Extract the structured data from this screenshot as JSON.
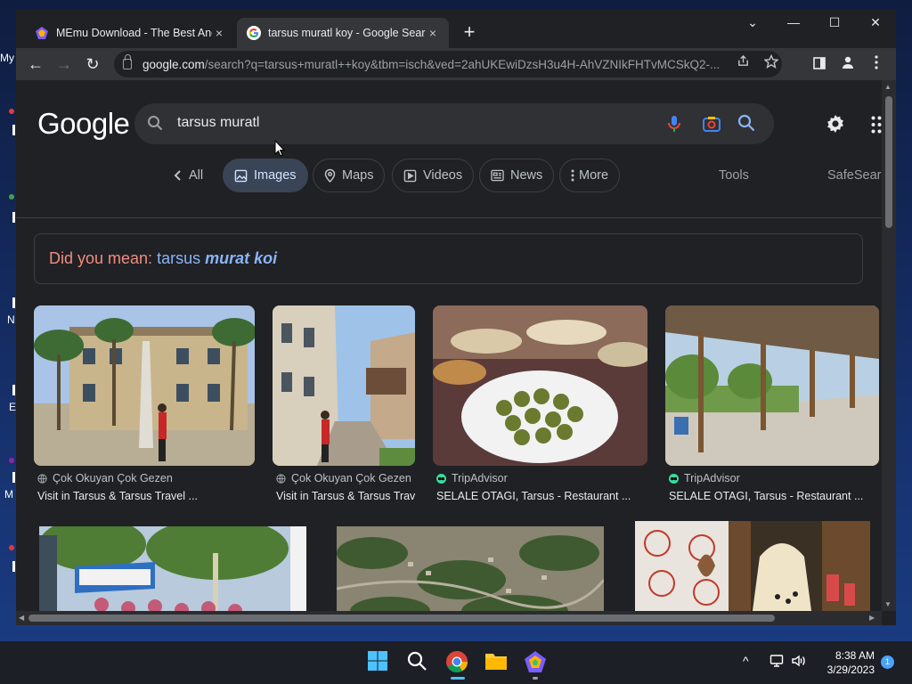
{
  "desktop": {
    "labels": [
      "My",
      "N",
      "E",
      "M"
    ]
  },
  "browser": {
    "tabs": [
      {
        "title": "MEmu Download - The Best Android Emulator",
        "close": "×",
        "icon": "memu-icon"
      },
      {
        "title": "tarsus muratl koy - Google Search",
        "close": "×",
        "icon": "google-g-icon"
      }
    ],
    "new_tab": "+",
    "window_controls": {
      "tab_search": "⌄",
      "minimize": "—",
      "maximize": "☐",
      "close": "✕"
    },
    "toolbar": {
      "back": "←",
      "forward": "→",
      "reload": "↻",
      "url_host": "google.com",
      "url_rest": "/search?q=tarsus+muratl++koy&tbm=isch&ved=2ahUKEwiDzsH3u4H-AhVZNIkFHTvMCSkQ2-..."
    }
  },
  "search": {
    "logo": "Google",
    "query": "tarsus muratl",
    "chips": [
      {
        "label": "All",
        "icon": "chevron-left-icon"
      },
      {
        "label": "Images",
        "icon": "image-icon"
      },
      {
        "label": "Maps",
        "icon": "map-pin-icon"
      },
      {
        "label": "Videos",
        "icon": "video-icon"
      },
      {
        "label": "News",
        "icon": "news-icon"
      },
      {
        "label": "More",
        "icon": "more-vert-icon"
      }
    ],
    "tools": "Tools",
    "safesearch": "SafeSearch",
    "did_you_mean": {
      "prefix": "Did you mean:",
      "normal": "tarsus",
      "bold": "murat koi"
    }
  },
  "results": [
    {
      "source": "Çok Okuyan Çok Gezen",
      "title": "Visit in Tarsus & Tarsus Travel ...",
      "icon": "globe-icon"
    },
    {
      "source": "Çok Okuyan Çok Gezen",
      "title": "Visit in Tarsus & Tarsus Travel ...",
      "icon": "globe-icon"
    },
    {
      "source": "TripAdvisor",
      "title": "SELALE OTAGI, Tarsus - Restaurant ...",
      "icon": "tripadvisor-icon"
    },
    {
      "source": "TripAdvisor",
      "title": "SELALE OTAGI, Tarsus - Restaurant ...",
      "icon": "tripadvisor-icon"
    }
  ],
  "taskbar": {
    "time": "8:38 AM",
    "date": "3/29/2023",
    "notifications": "1",
    "tray_chevron": "^"
  },
  "colors": {
    "page_bg": "#202124",
    "link": "#8ab4f8",
    "did_you_mean": "#f28b82",
    "active_chip": "#394457"
  }
}
